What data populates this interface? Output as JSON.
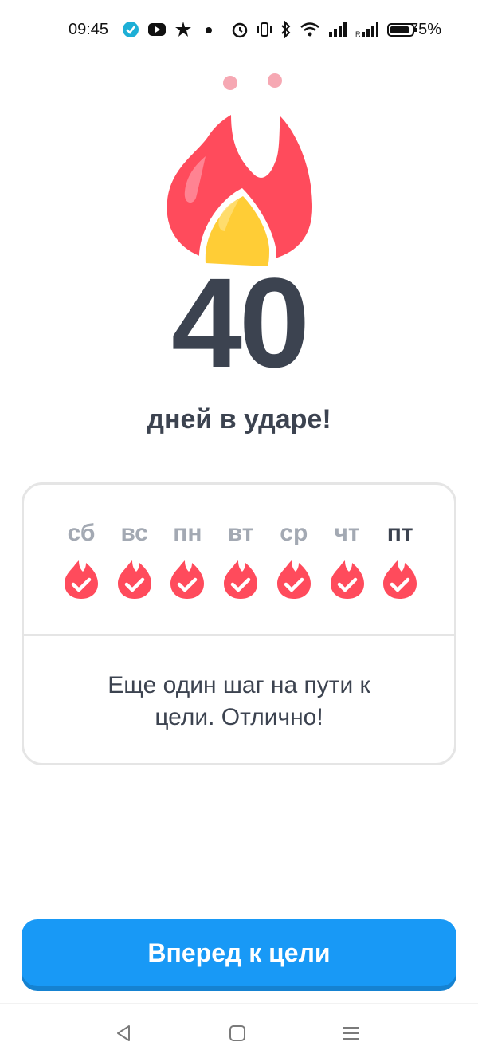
{
  "status_bar": {
    "time": "09:45",
    "battery": "75%",
    "icons": [
      "check-circle-icon",
      "youtube-icon",
      "app-icon",
      "dot-icon",
      "alarm-icon",
      "vibrate-icon",
      "bluetooth-icon",
      "wifi-icon",
      "signal-icon",
      "signal-roaming-icon",
      "battery-icon"
    ]
  },
  "streak": {
    "count": "40",
    "headline": "дней в ударе!"
  },
  "week": {
    "days": [
      {
        "label": "сб",
        "done": true,
        "current": false
      },
      {
        "label": "вс",
        "done": true,
        "current": false
      },
      {
        "label": "пн",
        "done": true,
        "current": false
      },
      {
        "label": "вт",
        "done": true,
        "current": false
      },
      {
        "label": "ср",
        "done": true,
        "current": false
      },
      {
        "label": "чт",
        "done": true,
        "current": false
      },
      {
        "label": "пт",
        "done": true,
        "current": true
      }
    ],
    "message": "Еще один шаг на пути к цели. Отлично!"
  },
  "actions": {
    "continue_label": "Вперед к цели"
  },
  "colors": {
    "flame_red": "#ff4b5c",
    "flame_yellow": "#ffcd36",
    "primary_blue": "#1899f6",
    "text_dark": "#3c4350",
    "text_muted": "#a3a9b3"
  },
  "nav": {
    "items": [
      "back-icon",
      "home-icon",
      "menu-icon"
    ]
  }
}
